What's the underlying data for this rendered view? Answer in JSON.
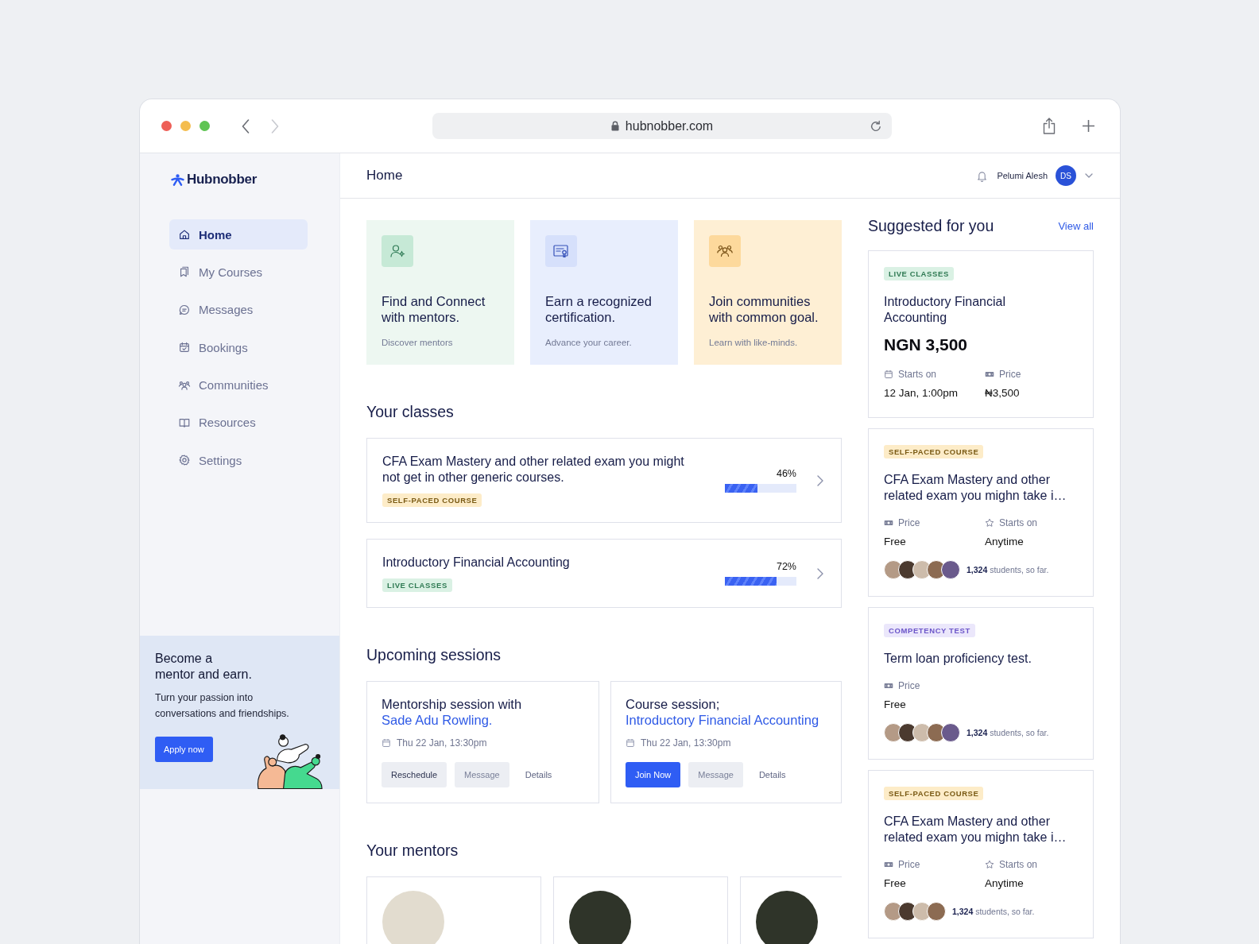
{
  "browser": {
    "url": "hubnobber.com",
    "back_disabled": false,
    "forward_disabled": true
  },
  "sidebar": {
    "logo": "Hubnobber",
    "items": [
      {
        "label": "Home",
        "selected": true
      },
      {
        "label": "My Courses",
        "selected": false
      },
      {
        "label": "Messages",
        "selected": false
      },
      {
        "label": "Bookings",
        "selected": false
      },
      {
        "label": "Communities",
        "selected": false
      },
      {
        "label": "Resources",
        "selected": false
      },
      {
        "label": "Settings",
        "selected": false
      }
    ],
    "promo": {
      "title": "Become a\nmentor and earn.",
      "text": "Turn your passion into conversations and friendships.",
      "button": "Apply now"
    }
  },
  "header": {
    "title": "Home",
    "user": {
      "name": "Pelumi Alesh",
      "initials": "DS"
    }
  },
  "features": [
    {
      "title": "Find and Connect with mentors.",
      "subtitle": "Discover mentors"
    },
    {
      "title": "Earn a recognized certification.",
      "subtitle": "Advance your career."
    },
    {
      "title": "Join communities with common goal.",
      "subtitle": "Learn with like-minds."
    }
  ],
  "classes": {
    "heading": "Your classes",
    "items": [
      {
        "title": "CFA Exam Mastery and other related exam you might not get in other generic courses.",
        "tag": {
          "label": "SELF-PACED COURSE",
          "kind": "self-paced"
        },
        "level": 0.46,
        "reading": "46%"
      },
      {
        "title": "Introductory Financial Accounting",
        "tag": {
          "label": "LIVE CLASSES",
          "kind": "live"
        },
        "level": 0.72,
        "reading": "72%"
      }
    ]
  },
  "sessions": {
    "heading": "Upcoming sessions",
    "items": [
      {
        "title": "Mentorship session with",
        "link": "Sade Adu Rowling.",
        "date": "Thu 22 Jan, 13:30pm",
        "buttons": [
          {
            "label": "Reschedule",
            "kind": "secondary"
          },
          {
            "label": "Message",
            "kind": "muted"
          },
          {
            "label": "Details",
            "kind": "text"
          }
        ]
      },
      {
        "title": "Course session;",
        "link": "Introductory Financial Accounting",
        "date": "Thu 22 Jan, 13:30pm",
        "buttons": [
          {
            "label": "Join Now",
            "kind": "primary"
          },
          {
            "label": "Message",
            "kind": "muted"
          },
          {
            "label": "Details",
            "kind": "text"
          }
        ]
      }
    ]
  },
  "mentors": {
    "heading": "Your mentors",
    "items": [
      {
        "kind": "photo"
      },
      {
        "kind": "photo"
      },
      {
        "kind": "photo"
      }
    ]
  },
  "suggested": {
    "heading": "Suggested for you",
    "link": "View all",
    "items": [
      {
        "tag": {
          "label": "LIVE CLASSES",
          "kind": "live"
        },
        "title": "Introductory Financial Accounting",
        "price": "NGN 3,500",
        "meta": [
          {
            "kind": "scheduled",
            "label": "Starts on",
            "value": "12 Jan, 1:00pm"
          },
          {
            "kind": "price",
            "label": "Price",
            "value": "₦3,500"
          }
        ]
      },
      {
        "tag": {
          "label": "SELF-PACED COURSE",
          "kind": "self-paced"
        },
        "title": "CFA Exam Mastery and other related exam you mighn take i…",
        "meta": [
          {
            "kind": "price",
            "label": "Price",
            "value": "Free"
          },
          {
            "kind": "flexible",
            "label": "Starts on",
            "value": "Anytime"
          }
        ],
        "students": {
          "avatars": [
            {
              "kind": "photo"
            },
            {
              "kind": "photo"
            },
            {
              "kind": "photo"
            },
            {
              "kind": "photo"
            },
            {
              "kind": "photo"
            }
          ],
          "text": "**1,324** students, so far."
        }
      },
      {
        "tag": {
          "label": "COMPETENCY TEST",
          "kind": "test"
        },
        "title": "Term loan proficiency test.",
        "meta": [
          {
            "kind": "price",
            "label": "Price",
            "value": "Free"
          }
        ],
        "students": {
          "avatars": [
            {
              "kind": "photo"
            },
            {
              "kind": "photo"
            },
            {
              "kind": "photo"
            },
            {
              "kind": "photo"
            },
            {
              "kind": "photo"
            }
          ],
          "text": "**1,324** students, so far."
        }
      },
      {
        "tag": {
          "label": "SELF-PACED COURSE",
          "kind": "self-paced"
        },
        "title": "CFA Exam Mastery and other related exam you mighn take i…",
        "meta": [
          {
            "kind": "price",
            "label": "Price",
            "value": "Free"
          },
          {
            "kind": "flexible",
            "label": "Starts on",
            "value": "Anytime"
          }
        ],
        "students": {
          "avatars": [
            {
              "kind": "photo"
            },
            {
              "kind": "photo"
            },
            {
              "kind": "photo"
            },
            {
              "kind": "photo"
            }
          ],
          "text": "**1,324** students, so far."
        }
      }
    ]
  }
}
